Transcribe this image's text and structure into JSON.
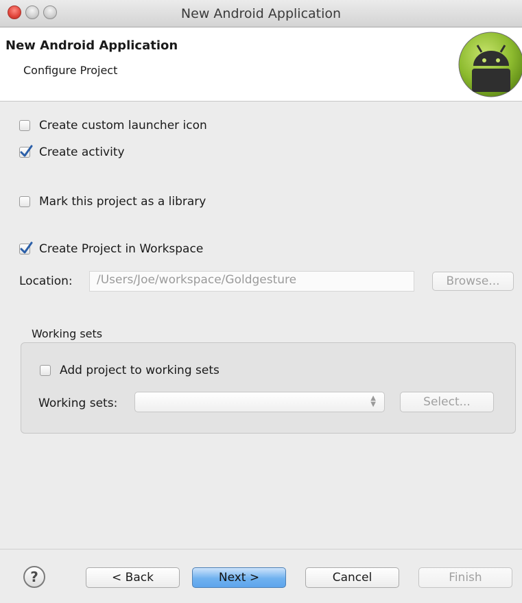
{
  "window": {
    "title": "New Android Application"
  },
  "header": {
    "title": "New Android Application",
    "subtitle": "Configure Project",
    "logo_icon": "android-logo-icon"
  },
  "options": {
    "custom_launcher": {
      "label": "Create custom launcher icon",
      "checked": false
    },
    "create_activity": {
      "label": "Create activity",
      "checked": true
    },
    "mark_library": {
      "label": "Mark this project as a library",
      "checked": false
    },
    "create_in_workspace": {
      "label": "Create Project in Workspace",
      "checked": true
    }
  },
  "location": {
    "label": "Location:",
    "value": "/Users/Joe/workspace/Goldgesture",
    "browse_label": "Browse..."
  },
  "working_sets": {
    "legend": "Working sets",
    "add_label": "Add project to working sets",
    "add_checked": false,
    "field_label": "Working sets:",
    "selected_value": "",
    "select_label": "Select..."
  },
  "footer": {
    "help_icon": "help-icon",
    "help_glyph": "?",
    "back_label": "< Back",
    "next_label": "Next >",
    "cancel_label": "Cancel",
    "finish_label": "Finish"
  },
  "colors": {
    "accent": "#5ea5ec",
    "check": "#2b5fa8",
    "android_green": "#8dbb2f"
  }
}
